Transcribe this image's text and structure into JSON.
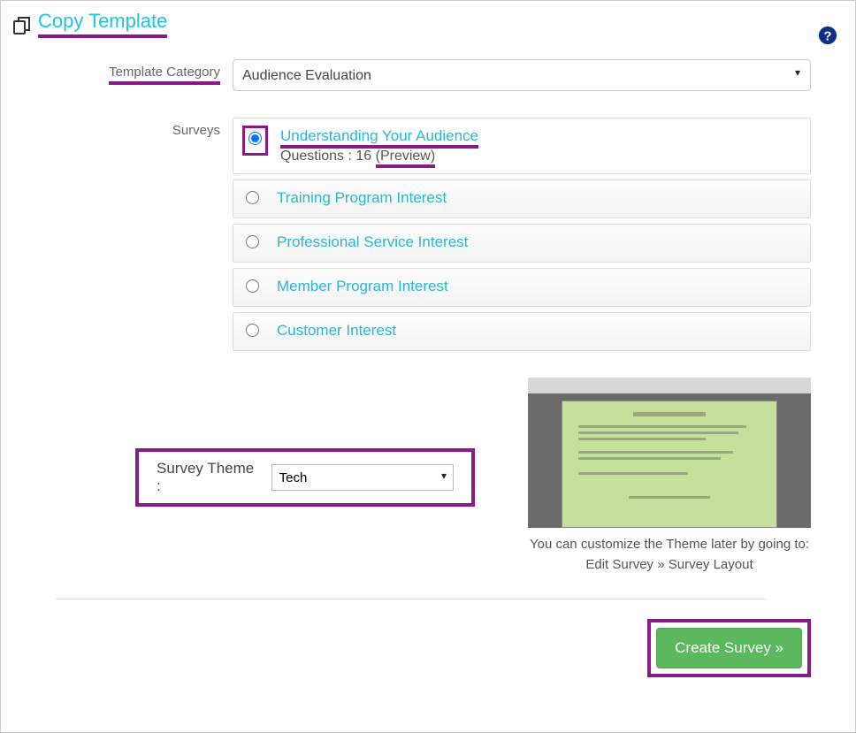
{
  "header": {
    "title": "Copy Template"
  },
  "labels": {
    "template_category": "Template Category",
    "surveys": "Surveys",
    "survey_theme": "Survey Theme :",
    "questions_prefix": "Questions : ",
    "preview": "(Preview)"
  },
  "template_category": {
    "selected": "Audience Evaluation"
  },
  "surveys": [
    {
      "title": "Understanding Your Audience",
      "questions": 16,
      "selected": true
    },
    {
      "title": "Training Program Interest",
      "selected": false
    },
    {
      "title": "Professional Service Interest",
      "selected": false
    },
    {
      "title": "Member Program Interest",
      "selected": false
    },
    {
      "title": "Customer Interest",
      "selected": false
    }
  ],
  "theme": {
    "selected": "Tech",
    "hint_line1": "You can customize the Theme later by going to:",
    "hint_line2": "Edit Survey » Survey Layout"
  },
  "buttons": {
    "create_survey": "Create Survey »"
  }
}
